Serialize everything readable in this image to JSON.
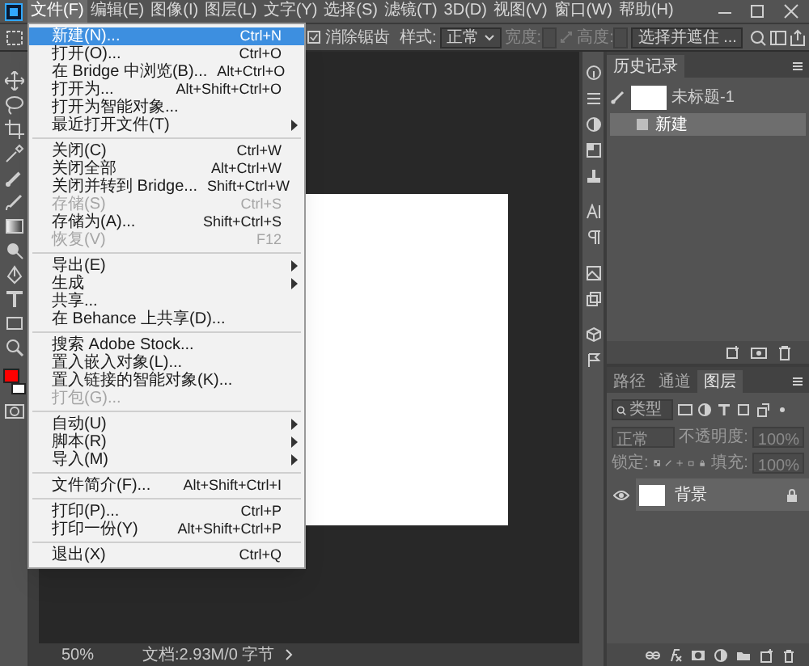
{
  "menu_bar": [
    {
      "label": "文件(F)",
      "selected": true
    },
    {
      "label": "编辑(E)",
      "selected": false
    },
    {
      "label": "图像(I)",
      "selected": false
    },
    {
      "label": "图层(L)",
      "selected": false
    },
    {
      "label": "文字(Y)",
      "selected": false
    },
    {
      "label": "选择(S)",
      "selected": false
    },
    {
      "label": "滤镜(T)",
      "selected": false
    },
    {
      "label": "3D(D)",
      "selected": false
    },
    {
      "label": "视图(V)",
      "selected": false
    },
    {
      "label": "窗口(W)",
      "selected": false
    },
    {
      "label": "帮助(H)",
      "selected": false
    }
  ],
  "options_bar": {
    "anti_alias": {
      "label": "消除锯齿",
      "checked": true
    },
    "style_label": "样式:",
    "style_value": "正常",
    "width_label": "宽度:",
    "height_label": "高度:",
    "select_and_mask": "选择并遮住 ..."
  },
  "file_menu": [
    {
      "kind": "item",
      "label": "新建(N)...",
      "shortcut": "Ctrl+N",
      "selected": true,
      "disabled": false,
      "submenu": false
    },
    {
      "kind": "item",
      "label": "打开(O)...",
      "shortcut": "Ctrl+O",
      "selected": false,
      "disabled": false,
      "submenu": false
    },
    {
      "kind": "item",
      "label": "在 Bridge 中浏览(B)...",
      "shortcut": "Alt+Ctrl+O",
      "selected": false,
      "disabled": false,
      "submenu": false
    },
    {
      "kind": "item",
      "label": "打开为...",
      "shortcut": "Alt+Shift+Ctrl+O",
      "selected": false,
      "disabled": false,
      "submenu": false
    },
    {
      "kind": "item",
      "label": "打开为智能对象...",
      "selected": false,
      "disabled": false,
      "submenu": false
    },
    {
      "kind": "item",
      "label": "最近打开文件(T)",
      "selected": false,
      "disabled": false,
      "submenu": true
    },
    {
      "kind": "separator"
    },
    {
      "kind": "item",
      "label": "关闭(C)",
      "shortcut": "Ctrl+W",
      "selected": false,
      "disabled": false,
      "submenu": false
    },
    {
      "kind": "item",
      "label": "关闭全部",
      "shortcut": "Alt+Ctrl+W",
      "selected": false,
      "disabled": false,
      "submenu": false
    },
    {
      "kind": "item",
      "label": "关闭并转到 Bridge...",
      "shortcut": "Shift+Ctrl+W",
      "selected": false,
      "disabled": false,
      "submenu": false
    },
    {
      "kind": "item",
      "label": "存储(S)",
      "shortcut": "Ctrl+S",
      "selected": false,
      "disabled": true,
      "submenu": false
    },
    {
      "kind": "item",
      "label": "存储为(A)...",
      "shortcut": "Shift+Ctrl+S",
      "selected": false,
      "disabled": false,
      "submenu": false
    },
    {
      "kind": "item",
      "label": "恢复(V)",
      "shortcut": "F12",
      "selected": false,
      "disabled": true,
      "submenu": false
    },
    {
      "kind": "separator"
    },
    {
      "kind": "item",
      "label": "导出(E)",
      "selected": false,
      "disabled": false,
      "submenu": true
    },
    {
      "kind": "item",
      "label": "生成",
      "selected": false,
      "disabled": false,
      "submenu": true
    },
    {
      "kind": "item",
      "label": "共享...",
      "selected": false,
      "disabled": false,
      "submenu": false
    },
    {
      "kind": "item",
      "label": "在 Behance 上共享(D)...",
      "selected": false,
      "disabled": false,
      "submenu": false
    },
    {
      "kind": "separator"
    },
    {
      "kind": "item",
      "label": "搜索 Adobe Stock...",
      "selected": false,
      "disabled": false,
      "submenu": false
    },
    {
      "kind": "item",
      "label": "置入嵌入对象(L)...",
      "selected": false,
      "disabled": false,
      "submenu": false
    },
    {
      "kind": "item",
      "label": "置入链接的智能对象(K)...",
      "selected": false,
      "disabled": false,
      "submenu": false
    },
    {
      "kind": "item",
      "label": "打包(G)...",
      "selected": false,
      "disabled": true,
      "submenu": false
    },
    {
      "kind": "separator"
    },
    {
      "kind": "item",
      "label": "自动(U)",
      "selected": false,
      "disabled": false,
      "submenu": true
    },
    {
      "kind": "item",
      "label": "脚本(R)",
      "selected": false,
      "disabled": false,
      "submenu": true
    },
    {
      "kind": "item",
      "label": "导入(M)",
      "selected": false,
      "disabled": false,
      "submenu": true
    },
    {
      "kind": "separator"
    },
    {
      "kind": "item",
      "label": "文件简介(F)...",
      "shortcut": "Alt+Shift+Ctrl+I",
      "selected": false,
      "disabled": false,
      "submenu": false
    },
    {
      "kind": "separator"
    },
    {
      "kind": "item",
      "label": "打印(P)...",
      "shortcut": "Ctrl+P",
      "selected": false,
      "disabled": false,
      "submenu": false
    },
    {
      "kind": "item",
      "label": "打印一份(Y)",
      "shortcut": "Alt+Shift+Ctrl+P",
      "selected": false,
      "disabled": false,
      "submenu": false
    },
    {
      "kind": "separator"
    },
    {
      "kind": "item",
      "label": "退出(X)",
      "shortcut": "Ctrl+Q",
      "selected": false,
      "disabled": false,
      "submenu": false
    }
  ],
  "swatches": [
    {
      "kind": "foreground",
      "color": "#ff0000"
    },
    {
      "kind": "background",
      "color": "#ffffff"
    }
  ],
  "history_panel": {
    "tab": "历史记录",
    "snapshot": "未标题-1",
    "states": [
      {
        "label": "新建",
        "selected": true
      }
    ]
  },
  "layers_panel": {
    "tabs": [
      {
        "label": "路径",
        "selected": false
      },
      {
        "label": "通道",
        "selected": false
      },
      {
        "label": "图层",
        "selected": true
      }
    ],
    "filter_placeholder": "类型",
    "blend_mode": "正常",
    "opacity_label": "不透明度:",
    "opacity_value": "100%",
    "lock_label": "锁定:",
    "fill_label": "填充:",
    "fill_value": "100%",
    "layers": [
      {
        "name": "背景",
        "visible": true,
        "locked": true
      }
    ]
  },
  "status_bar": {
    "zoom": "50%",
    "doc_info": "文档:2.93M/0 字节"
  }
}
